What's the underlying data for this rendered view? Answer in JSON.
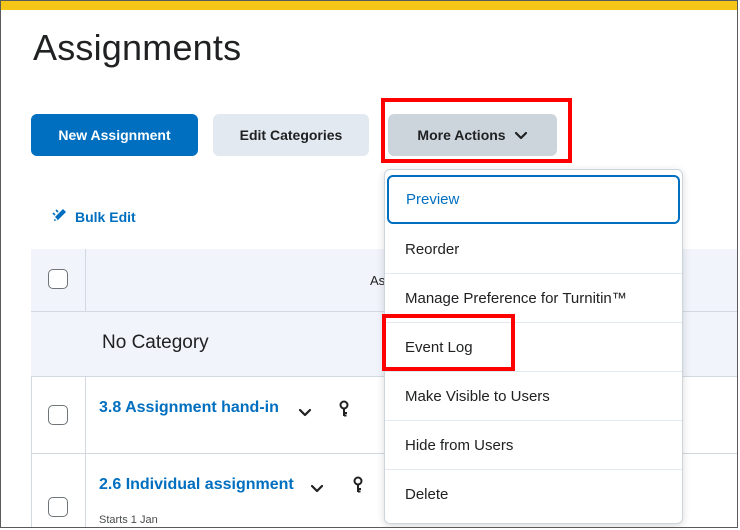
{
  "page": {
    "title": "Assignments"
  },
  "toolbar": {
    "new_assignment": "New Assignment",
    "edit_categories": "Edit Categories",
    "more_actions": "More Actions"
  },
  "bulk_edit": {
    "label": "Bulk Edit"
  },
  "table": {
    "header_partial": "As",
    "category": "No Category",
    "rows": [
      {
        "title": "3.8 Assignment hand-in",
        "sub": ""
      },
      {
        "title": "2.6 Individual assignment",
        "sub": "Starts 1 Jan"
      }
    ]
  },
  "menu": {
    "items": [
      {
        "label": "Preview"
      },
      {
        "label": "Reorder"
      },
      {
        "label": "Manage Preference for Turnitin™"
      },
      {
        "label": "Event Log"
      },
      {
        "label": "Make Visible to Users"
      },
      {
        "label": "Hide from Users"
      },
      {
        "label": "Delete"
      }
    ]
  },
  "colors": {
    "accent": "#006fbf",
    "top_bar": "#f5c518",
    "highlight": "#ff0000"
  }
}
